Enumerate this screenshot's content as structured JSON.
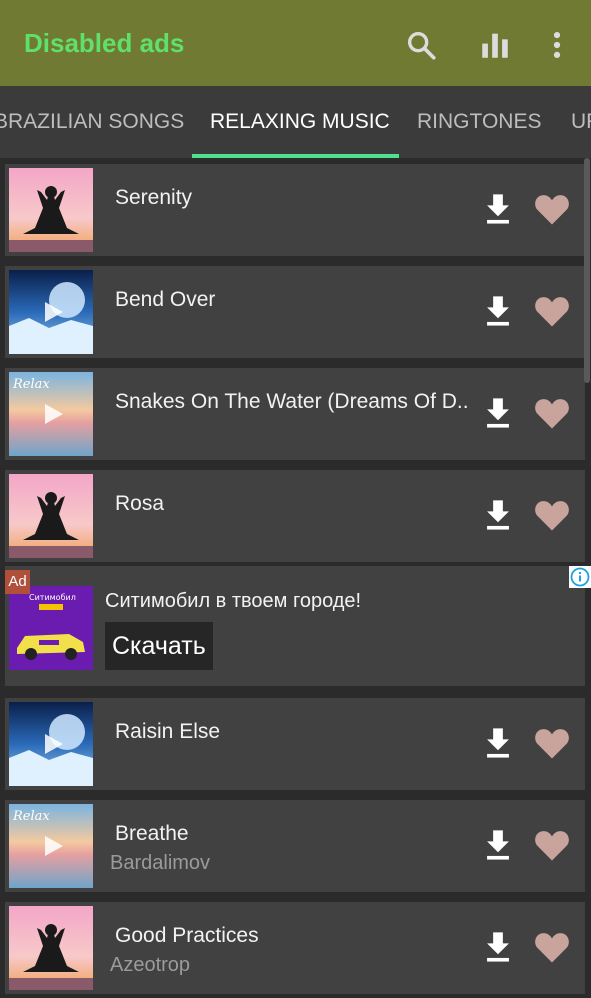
{
  "app": {
    "title": "Disabled ads",
    "title_color": "#5fe06a",
    "bar_color": "#707a32"
  },
  "toolbar": {
    "icons": [
      "search-icon",
      "equalizer-icon",
      "more-vert-icon"
    ]
  },
  "tabs": [
    {
      "label": "BRAZILIAN SONGS",
      "active": false
    },
    {
      "label": "RELAXING MUSIC",
      "active": true
    },
    {
      "label": "RINGTONES",
      "active": false
    },
    {
      "label": "UR",
      "active": false
    }
  ],
  "tab_indicator_color": "#4fe08f",
  "songs": [
    {
      "title": "Serenity",
      "artist": "",
      "thumbnail": "yoga-sunset"
    },
    {
      "title": "Bend Over",
      "artist": "",
      "thumbnail": "blue-moon-landscape"
    },
    {
      "title": "Snakes On The Water (Dreams Of D..",
      "artist": "",
      "thumbnail": "relax-beach"
    },
    {
      "title": "Rosa",
      "artist": "",
      "thumbnail": "yoga-sunset"
    },
    {
      "title": "Raisin Else",
      "artist": "",
      "thumbnail": "blue-moon-landscape"
    },
    {
      "title": "Breathe",
      "artist": "Bardalimov",
      "thumbnail": "relax-beach"
    },
    {
      "title": "Good Practices",
      "artist": "Azeotrop",
      "thumbnail": "yoga-sunset"
    }
  ],
  "ad": {
    "label": "Ad",
    "text": "Ситимобил в твоем городе!",
    "cta": "Скачать",
    "thumb_text": "Ситимобил",
    "info_icon": "info-icon"
  },
  "colors": {
    "heart": "#c9a49c",
    "download": "#ffffff"
  }
}
